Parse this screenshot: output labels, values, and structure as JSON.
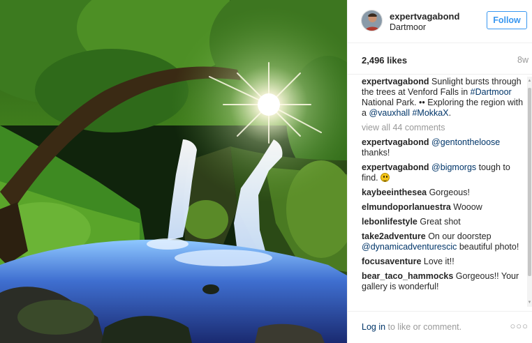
{
  "header": {
    "username": "expertvagabond",
    "location": "Dartmoor",
    "follow_label": "Follow"
  },
  "stats": {
    "likes": "2,496 likes",
    "time_ago": "8w"
  },
  "caption": {
    "user": "expertvagabond",
    "text_1": " Sunlight bursts through the trees at Venford Falls in ",
    "tag_1": "#Dartmoor",
    "text_2": " National Park. •• Exploring the region with a ",
    "mention_1": "@vauxhall",
    "text_3": " ",
    "tag_2": "#MokkaX",
    "text_4": "."
  },
  "view_all_comments": "view all 44 comments",
  "comments": [
    {
      "user": "expertvagabond",
      "mention": "@gentontheloose",
      "text": " thanks!"
    },
    {
      "user": "expertvagabond",
      "mention": "@bigmorgs",
      "text": " tough to find. "
    },
    {
      "user": "kaybeeinthesea",
      "text": " Gorgeous!"
    },
    {
      "user": "elmundoporlanuestra",
      "text": " Wooow"
    },
    {
      "user": "lebonlifestyle",
      "text": " Great shot"
    },
    {
      "user": "take2adventure",
      "text": " On our doorstep ",
      "mention": "@dynamicadventurescic",
      "text_after": " beautiful photo!"
    },
    {
      "user": "focusaventure",
      "text": " Love it!!"
    },
    {
      "user": "bear_taco_hammocks",
      "text": " Gorgeous!! Your gallery is wonderful!"
    }
  ],
  "footer": {
    "login_link": "Log in",
    "login_rest": " to like or comment.",
    "more": "○○○"
  },
  "icons": {
    "emoji": "smiling-face-emoji",
    "more": "more-options-icon"
  },
  "colors": {
    "link": "#003569",
    "follow": "#3897f0",
    "muted": "#999999"
  }
}
